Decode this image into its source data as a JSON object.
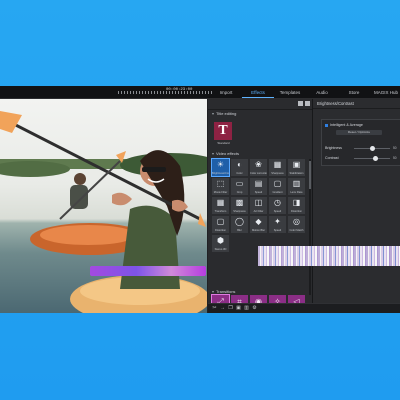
{
  "topbar": {
    "timecode": "00:00:23:00",
    "tabs": [
      {
        "label": "Import",
        "active": false
      },
      {
        "label": "Effects",
        "active": true
      },
      {
        "label": "Templates",
        "active": false
      },
      {
        "label": "Audio",
        "active": false
      },
      {
        "label": "Store",
        "active": false
      },
      {
        "label": "MAGIX Hub",
        "active": false
      }
    ]
  },
  "effects_panel": {
    "title_section": "Title editing",
    "title_tile_label": "Standard",
    "video_effects_section": "Video effects",
    "effects": [
      {
        "icon": "brightness-icon",
        "glyph": "☀",
        "label": "Brightness/Contrast",
        "active": true
      },
      {
        "icon": "color-palette-icon",
        "glyph": "◐",
        "label": "Color"
      },
      {
        "icon": "color-correction-icon",
        "glyph": "❀",
        "label": "Color correction"
      },
      {
        "icon": "sharpness-icon",
        "glyph": "▦",
        "label": "Sharpness"
      },
      {
        "icon": "display-icon",
        "glyph": "▣",
        "label": "Stabilization"
      },
      {
        "icon": "filter-icon",
        "glyph": "⬚",
        "label": "Movie Filter"
      },
      {
        "icon": "crop-icon",
        "glyph": "▭",
        "label": "Crop"
      },
      {
        "icon": "image-icon",
        "glyph": "▤",
        "label": "Speed"
      },
      {
        "icon": "frame-icon",
        "glyph": "▢",
        "label": "Gradient"
      },
      {
        "icon": "chart-icon",
        "glyph": "▥",
        "label": "Lens Flare"
      },
      {
        "icon": "grid-icon",
        "glyph": "▦",
        "label": "Transform"
      },
      {
        "icon": "mosaic-icon",
        "glyph": "▩",
        "label": "Sharpness"
      },
      {
        "icon": "tiles-icon",
        "glyph": "◫",
        "label": "Art Filter"
      },
      {
        "icon": "clock-icon",
        "glyph": "◷",
        "label": "Speed"
      },
      {
        "icon": "puzzle-icon",
        "glyph": "◨",
        "label": "Distortion"
      },
      {
        "icon": "shape-icon",
        "glyph": "▢",
        "label": "Distortion"
      },
      {
        "icon": "blur-icon",
        "glyph": "◯",
        "label": "Blur"
      },
      {
        "icon": "drop-icon",
        "glyph": "◆",
        "label": "Motion Blur"
      },
      {
        "icon": "fire-icon",
        "glyph": "✦",
        "label": "Speed"
      },
      {
        "icon": "lens-icon",
        "glyph": "◎",
        "label": "Color Match"
      },
      {
        "icon": "hexagon-icon",
        "glyph": "⬢",
        "label": "Stereo 3D"
      }
    ],
    "transitions_section": "Transitions",
    "transitions": [
      {
        "icon": "scale-icon",
        "glyph": "⤢",
        "active": true
      },
      {
        "icon": "crop-transition-icon",
        "glyph": "⌗"
      },
      {
        "icon": "eye-icon",
        "glyph": "◉"
      },
      {
        "icon": "sparkle-icon",
        "glyph": "✧"
      },
      {
        "icon": "wipe-icon",
        "glyph": "◁"
      }
    ]
  },
  "properties": {
    "title": "Brightness/Contrast",
    "auto_label": "Intelligent & Average",
    "reset_label": "Reset / Optimize",
    "rows": [
      {
        "label": "Brightness",
        "value": "50",
        "fraction": 0.5
      },
      {
        "label": "Contrast",
        "value": "50",
        "fraction": 0.6
      }
    ]
  },
  "colors": {
    "background": "#27a7f2",
    "app": "#202124",
    "accent": "#5fb3ff",
    "title_tile": "#8e2243",
    "transition_tile": "#8b2e86"
  }
}
